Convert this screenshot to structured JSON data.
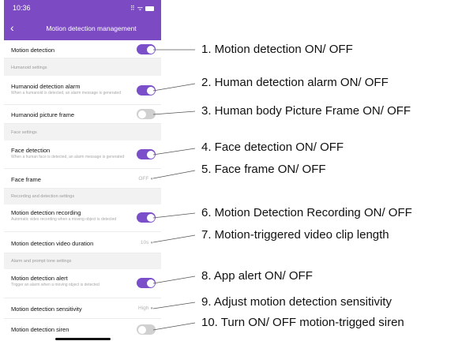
{
  "status_bar": {
    "time": "10:36",
    "signal_icon": "signal-dots-icon",
    "wifi_icon": "wifi-icon",
    "battery_icon": "battery-icon"
  },
  "nav": {
    "back_icon": "chevron-left-icon",
    "title": "Motion detection management"
  },
  "rows": {
    "motion_detection": {
      "title": "Motion detection",
      "toggle": "on"
    },
    "humanoid_section": "Humanoid settings",
    "humanoid_alarm": {
      "title": "Humanoid detection alarm",
      "desc": "When a humanoid is detected, an alarm message is generated",
      "toggle": "on"
    },
    "humanoid_frame": {
      "title": "Humanoid picture frame",
      "toggle": "off"
    },
    "face_section": "Face settings",
    "face_detection": {
      "title": "Face detection",
      "desc": "When a human face is detected, an alarm message is generated",
      "toggle": "on"
    },
    "face_frame": {
      "title": "Face frame",
      "value": "OFF"
    },
    "recording_section": "Recording and detection settings",
    "motion_recording": {
      "title": "Motion detection recording",
      "desc": "Automatic video recording when a moving object is detected",
      "toggle": "on"
    },
    "video_duration": {
      "title": "Motion detection video duration",
      "value": "10s"
    },
    "alarm_section": "Alarm and prompt tone settings",
    "motion_alert": {
      "title": "Motion detection alert",
      "desc": "Trigger an alarm when a moving object is detected",
      "toggle": "on"
    },
    "sensitivity": {
      "title": "Motion detection sensitivity",
      "value": "High"
    },
    "siren": {
      "title": "Motion detection siren",
      "toggle": "off"
    }
  },
  "callouts": [
    "1. Motion detection ON/ OFF",
    "2. Human detection alarm ON/ OFF",
    "3. Human body Picture Frame ON/ OFF",
    "4. Face detection ON/ OFF",
    "5. Face frame ON/ OFF",
    "6. Motion Detection Recording ON/ OFF",
    "7. Motion-triggered video clip length",
    "8. App alert ON/ OFF",
    "9. Adjust motion detection sensitivity",
    "10. Turn ON/ OFF motion-trigged siren"
  ],
  "colors": {
    "accent": "#7c4bc4",
    "toggle_on": "#7a4fc9",
    "toggle_off": "#d0d0d0",
    "section_bg": "#f2f2f2"
  }
}
